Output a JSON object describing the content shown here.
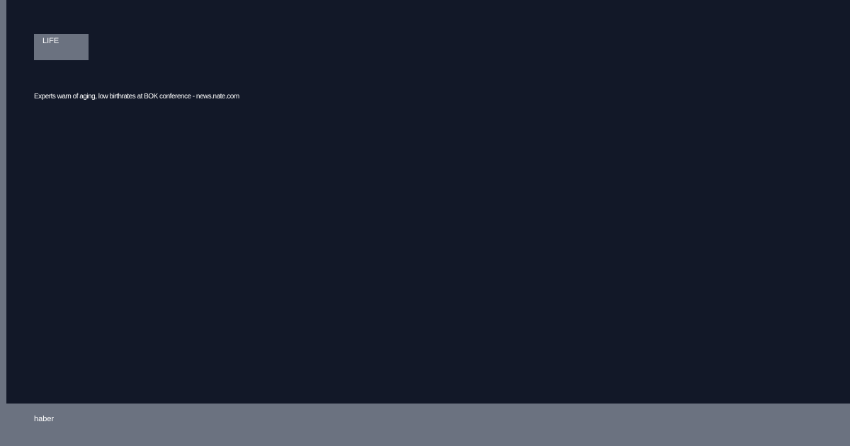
{
  "card": {
    "category": "LIFE",
    "headline": "Experts warn of aging, low birthrates at BOK conference - news.nate.com"
  },
  "footer": {
    "label": "haber"
  },
  "colors": {
    "background": "#121828",
    "accent": "#6b7280",
    "text": "#ffffff"
  }
}
